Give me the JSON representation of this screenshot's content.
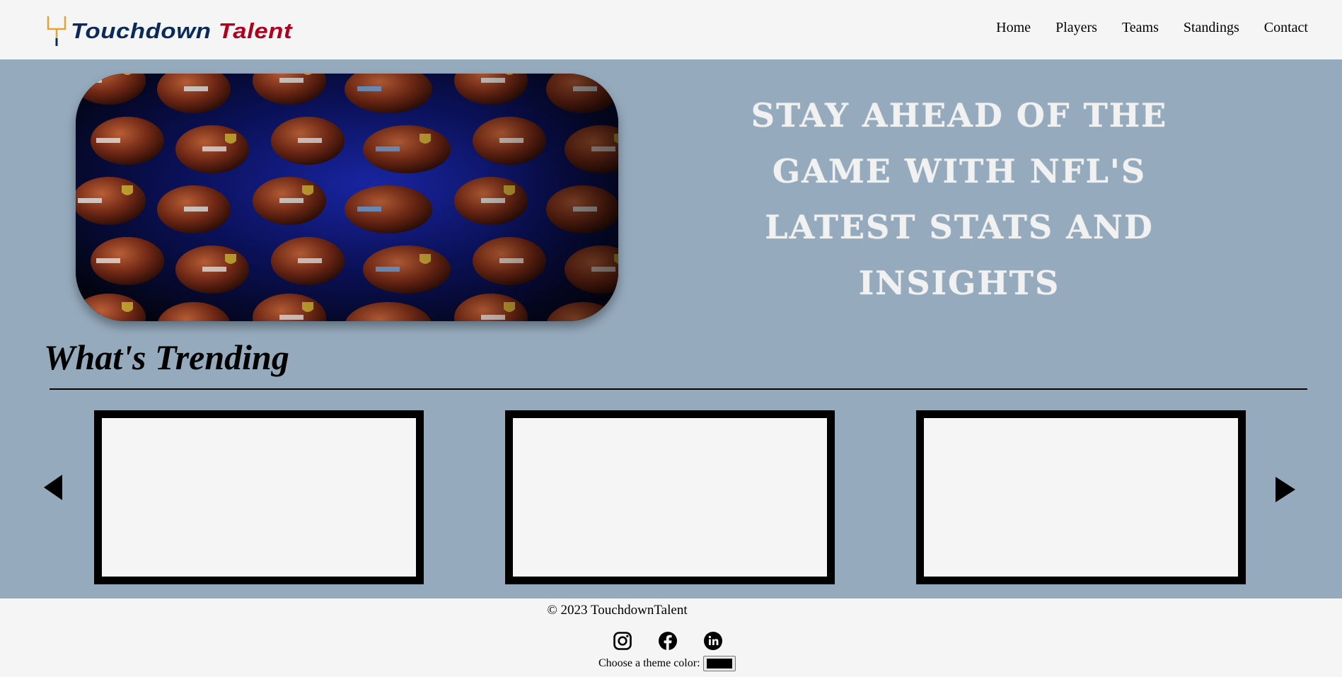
{
  "header": {
    "brand_word1": "Touchdown",
    "brand_word2": "Talent",
    "nav": [
      "Home",
      "Players",
      "Teams",
      "Standings",
      "Contact"
    ]
  },
  "hero": {
    "image_icon": "football-rack-photo",
    "headline": "Stay ahead of the game with NFL's latest stats and insights"
  },
  "trending": {
    "title": "What's Trending",
    "prev_icon": "triangle-left-icon",
    "next_icon": "triangle-right-icon",
    "card_count": 3
  },
  "footer": {
    "copyright": "© 2023 TouchdownTalent",
    "socials": [
      "instagram-icon",
      "facebook-icon",
      "linkedin-icon"
    ],
    "theme_label": "Choose a theme color:",
    "theme_value": "#000000"
  },
  "colors": {
    "band": "#95aabd",
    "page": "#f5f5f5",
    "brand_navy": "#0b2a5a",
    "brand_red": "#b0001e",
    "goalpost_gold": "#e2a531"
  }
}
